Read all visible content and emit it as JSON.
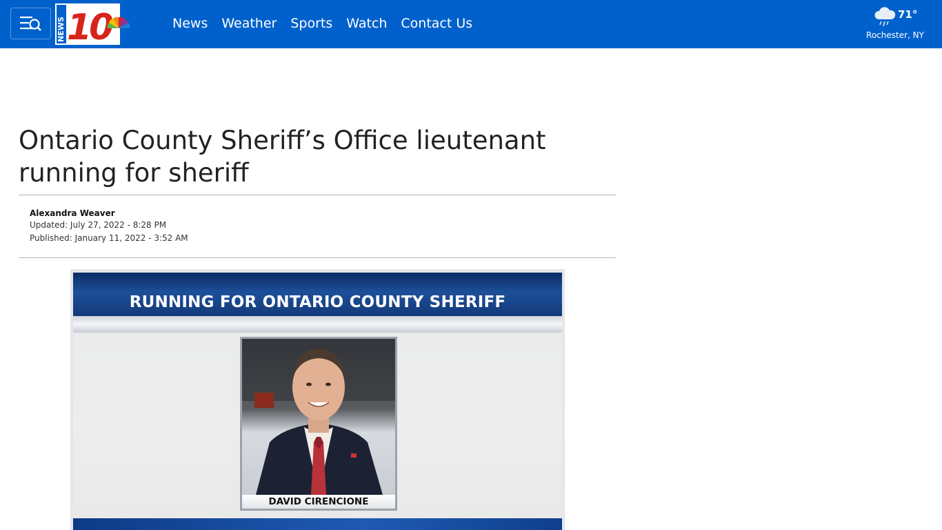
{
  "header": {
    "logo_alt": "News 10 NBC",
    "nav": [
      {
        "label": "News"
      },
      {
        "label": "Weather"
      },
      {
        "label": "Sports"
      },
      {
        "label": "Watch"
      },
      {
        "label": "Contact Us"
      }
    ],
    "weather": {
      "temp": "71°",
      "location": "Rochester, NY",
      "icon": "rain-cloud-icon"
    },
    "menu_icon": "menu-search-icon"
  },
  "article": {
    "headline": "Ontario County Sheriff’s Office lieutenant running for sheriff",
    "author": "Alexandra Weaver",
    "updated": "Updated: July 27, 2022 - 8:28 PM",
    "published": "Published: January 11, 2022 - 3:52 AM",
    "hero": {
      "banner_text": "RUNNING FOR ONTARIO COUNTY SHERIFF",
      "name_caption": "DAVID CIRENCIONE"
    }
  },
  "colors": {
    "brand_blue": "#0161cc",
    "rule": "#b5b5b5"
  }
}
